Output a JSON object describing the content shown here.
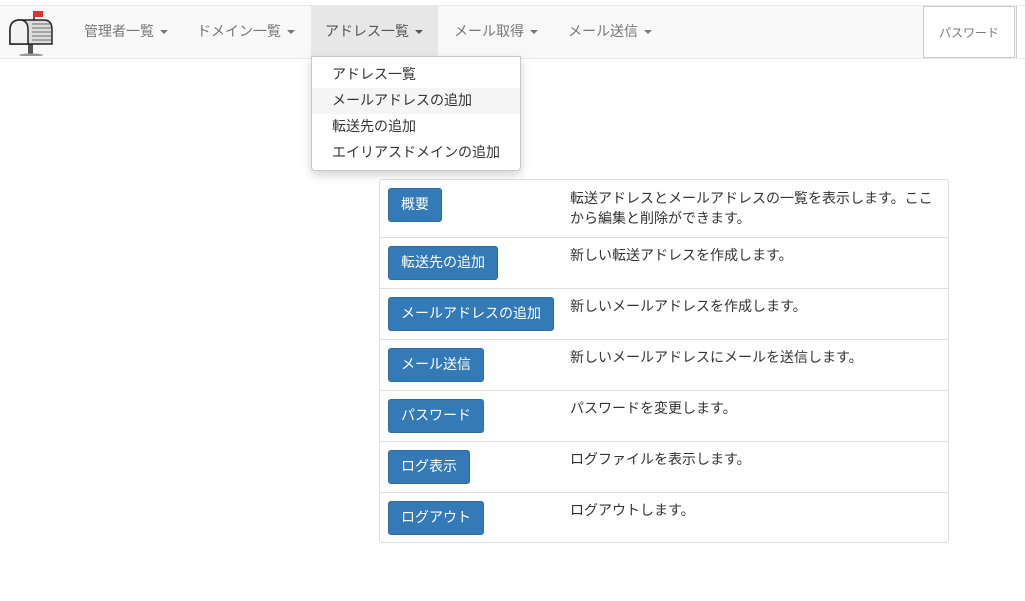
{
  "navbar": {
    "brand_icon": "mailbox-icon",
    "menus": [
      {
        "label": "管理者一覧"
      },
      {
        "label": "ドメイン一覧"
      },
      {
        "label": "アドレス一覧"
      },
      {
        "label": "メール取得"
      },
      {
        "label": "メール送信"
      }
    ],
    "password_label": "パスワード"
  },
  "dropdown": {
    "items": [
      {
        "label": "アドレス一覧"
      },
      {
        "label": "メールアドレスの追加"
      },
      {
        "label": "転送先の追加"
      },
      {
        "label": "エイリアスドメインの追加"
      }
    ]
  },
  "panel": {
    "rows": [
      {
        "button": "概要",
        "desc": "転送アドレスとメールアドレスの一覧を表示します。ここから編集と削除ができます。"
      },
      {
        "button": "転送先の追加",
        "desc": "新しい転送アドレスを作成します。"
      },
      {
        "button": "メールアドレスの追加",
        "desc": "新しいメールアドレスを作成します。"
      },
      {
        "button": "メール送信",
        "desc": "新しいメールアドレスにメールを送信します。"
      },
      {
        "button": "パスワード",
        "desc": "パスワードを変更します。"
      },
      {
        "button": "ログ表示",
        "desc": "ログファイルを表示します。"
      },
      {
        "button": "ログアウト",
        "desc": "ログアウトします。"
      }
    ]
  },
  "colors": {
    "primary": "#337ab7",
    "navbar_bg": "#f8f8f8",
    "active_menu_bg": "#e7e7e7"
  }
}
